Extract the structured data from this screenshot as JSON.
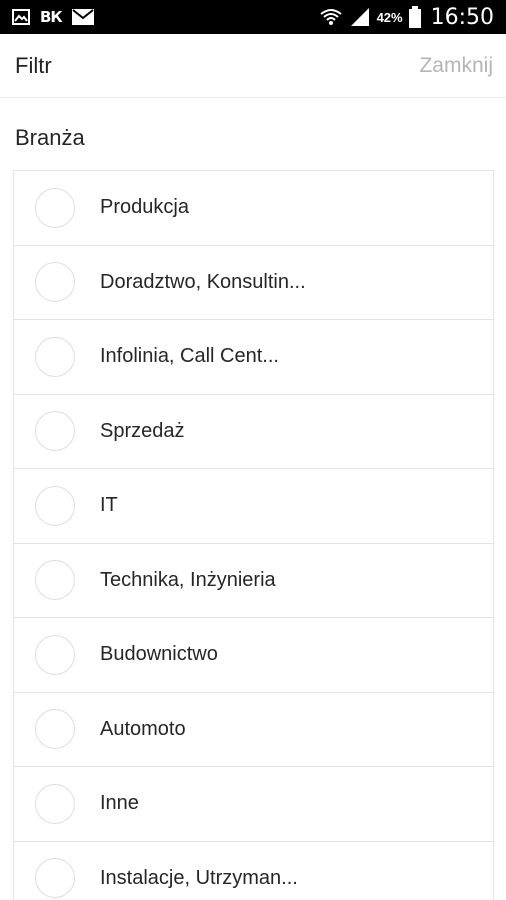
{
  "status_bar": {
    "icons_left": [
      "gallery-icon",
      "vk-icon",
      "mail-icon"
    ],
    "vk_text": "ВК",
    "battery": "42%",
    "time": "16:50"
  },
  "header": {
    "title": "Filtr",
    "close_label": "Zamknij"
  },
  "section": {
    "label": "Branża"
  },
  "options": [
    {
      "label": "Produkcja"
    },
    {
      "label": "Doradztwo, Konsultin..."
    },
    {
      "label": "Infolinia, Call Cent..."
    },
    {
      "label": "Sprzedaż"
    },
    {
      "label": "IT"
    },
    {
      "label": "Technika, Inżynieria"
    },
    {
      "label": "Budownictwo"
    },
    {
      "label": "Automoto"
    },
    {
      "label": "Inne"
    },
    {
      "label": "Instalacje, Utrzyman..."
    }
  ],
  "colors": {
    "status_bar_bg": "#000000",
    "close_text": "#b5b5b5",
    "divider": "#e3e3e3"
  }
}
